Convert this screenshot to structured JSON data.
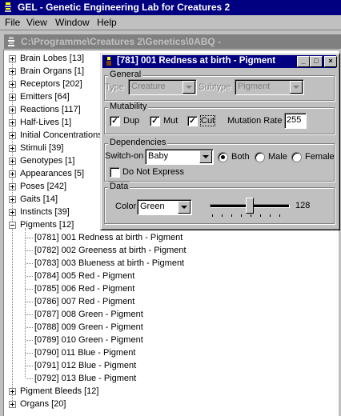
{
  "app": {
    "title": "GEL - Genetic Engineering Lab for Creatures 2",
    "icon": "gel-app-icon"
  },
  "menu": {
    "items": [
      "File",
      "View",
      "Window",
      "Help"
    ]
  },
  "child_window": {
    "title": "C:\\Programme\\Creatures 2\\Genetics\\0ABQ -"
  },
  "tree": {
    "top_items": [
      "Brain Lobes [13]",
      "Brain Organs [1]",
      "Receptors [202]",
      "Emitters [64]",
      "Reactions [117]",
      "Half-Lives [1]",
      "Initial Concentrations",
      "Stimuli [39]",
      "Genotypes [1]",
      "Appearances [5]",
      "Poses [242]",
      "Gaits [14]",
      "Instincts [39]",
      "Pigments [12]"
    ],
    "pigment_children": [
      "[0781] 001 Redness at birth - Pigment",
      "[0782] 002 Greeness at birth - Pigment",
      "[0783] 003 Blueness at birth - Pigment",
      "[0784] 005 Red - Pigment",
      "[0785] 006 Red - Pigment",
      "[0786] 007 Red - Pigment",
      "[0787] 008 Green - Pigment",
      "[0788] 009 Green - Pigment",
      "[0789] 010 Green - Pigment",
      "[0790] 011 Blue - Pigment",
      "[0791] 012 Blue - Pigment",
      "[0792] 013 Blue - Pigment"
    ],
    "bottom_items": [
      "Pigment Bleeds [12]",
      "Organs [20]"
    ]
  },
  "dialog": {
    "title": "[781] 001 Redness at birth - Pigment",
    "general": {
      "label": "General",
      "type_label": "Type",
      "type_value": "Creature",
      "subtype_label": "Subtype",
      "subtype_value": "Pigment"
    },
    "mutability": {
      "label": "Mutability",
      "dup_label": "Dup",
      "dup_checked": true,
      "mut_label": "Mut",
      "mut_checked": true,
      "cut_label": "Cut",
      "cut_checked": true,
      "rate_label": "Mutation Rate",
      "rate_value": "255"
    },
    "dependencies": {
      "label": "Dependencies",
      "switch_on_label": "Switch-on",
      "switch_on_value": "Baby",
      "both_label": "Both",
      "male_label": "Male",
      "female_label": "Female",
      "selected_sex": "Both",
      "do_not_express_label": "Do Not Express",
      "do_not_express_checked": false
    },
    "data": {
      "label": "Data",
      "color_label": "Color",
      "color_value": "Green",
      "slider_value": "128",
      "slider_fraction": 0.5
    }
  },
  "colors": {
    "title_active": "#000080",
    "title_inactive": "#808080",
    "face": "#c0c0c0"
  }
}
